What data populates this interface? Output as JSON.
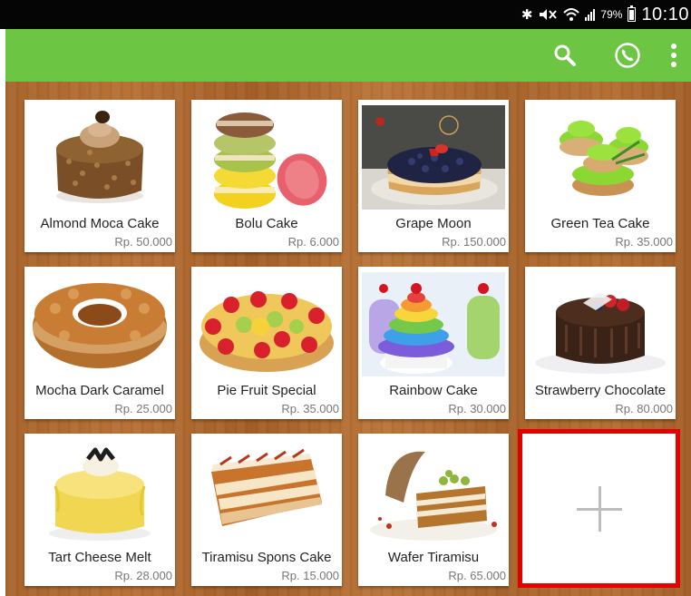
{
  "status_bar": {
    "battery": "79%",
    "time": "10:10",
    "icons": [
      "bluetooth-icon",
      "mute-icon",
      "wifi-icon",
      "signal-icon",
      "battery-icon"
    ]
  },
  "app_bar": {
    "color": "#6cc644",
    "actions": [
      "search-icon",
      "phone-icon",
      "overflow-menu-icon"
    ]
  },
  "products": [
    {
      "name": "Almond Moca Cake",
      "price": "Rp. 50.000"
    },
    {
      "name": "Bolu Cake",
      "price": "Rp. 6.000"
    },
    {
      "name": "Grape Moon",
      "price": "Rp. 150.000"
    },
    {
      "name": "Green Tea Cake",
      "price": "Rp. 35.000"
    },
    {
      "name": "Mocha Dark Caramel",
      "price": "Rp. 25.000"
    },
    {
      "name": "Pie Fruit Special",
      "price": "Rp. 35.000"
    },
    {
      "name": "Rainbow Cake",
      "price": "Rp. 30.000"
    },
    {
      "name": "Strawberry Chocolate",
      "price": "Rp. 80.000"
    },
    {
      "name": "Tart Cheese Melt",
      "price": "Rp. 28.000"
    },
    {
      "name": "Tiramisu Spons Cake",
      "price": "Rp. 15.000"
    },
    {
      "name": "Wafer Tiramisu",
      "price": "Rp. 65.000"
    }
  ],
  "add_tile": {
    "icon": "plus-icon",
    "highlight_color": "#e40000"
  }
}
